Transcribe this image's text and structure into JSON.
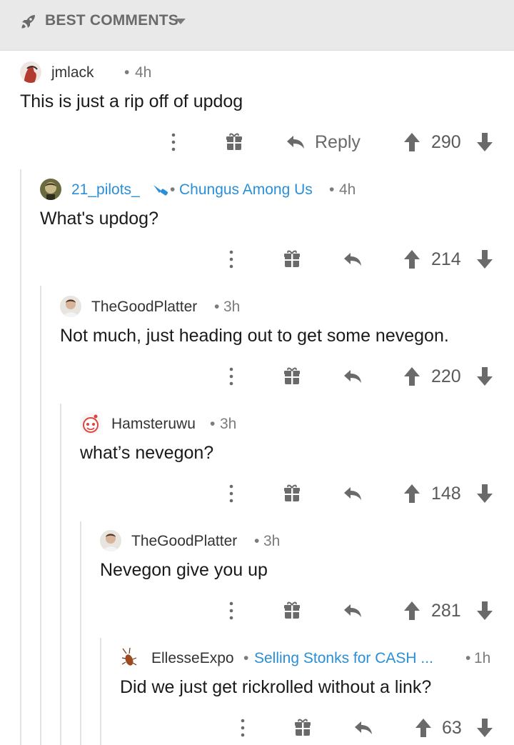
{
  "header": {
    "title": "BEST COMMENTS"
  },
  "comments": [
    {
      "user": "jmlack",
      "flair": "",
      "time": "4h",
      "body": "This is just a rip off of updog",
      "score": "290",
      "reply_label": "Reply"
    },
    {
      "user": "21_pilots_",
      "flair": "Chungus Among Us",
      "time": "4h",
      "body": "What's updog?",
      "score": "214",
      "reply_label": ""
    },
    {
      "user": "TheGoodPlatter",
      "flair": "",
      "time": "3h",
      "body": "Not much, just heading out to get some nevegon.",
      "score": "220",
      "reply_label": ""
    },
    {
      "user": "Hamsteruwu",
      "flair": "",
      "time": "3h",
      "body": "what’s nevegon?",
      "score": "148",
      "reply_label": ""
    },
    {
      "user": "TheGoodPlatter",
      "flair": "",
      "time": "3h",
      "body": "Nevegon give you up",
      "score": "281",
      "reply_label": ""
    },
    {
      "user": "EllesseExpo",
      "flair": "Selling Stonks for CASH ...",
      "time": "1h",
      "body": "Did we just get rickrolled without a link?",
      "score": "63",
      "reply_label": ""
    }
  ],
  "separator": "•",
  "colors": {
    "header_bg": "#e9e9e9",
    "flair": "#2a8fd6",
    "icon": "#6a6a6a",
    "thread_line": "#e3e3e3"
  }
}
